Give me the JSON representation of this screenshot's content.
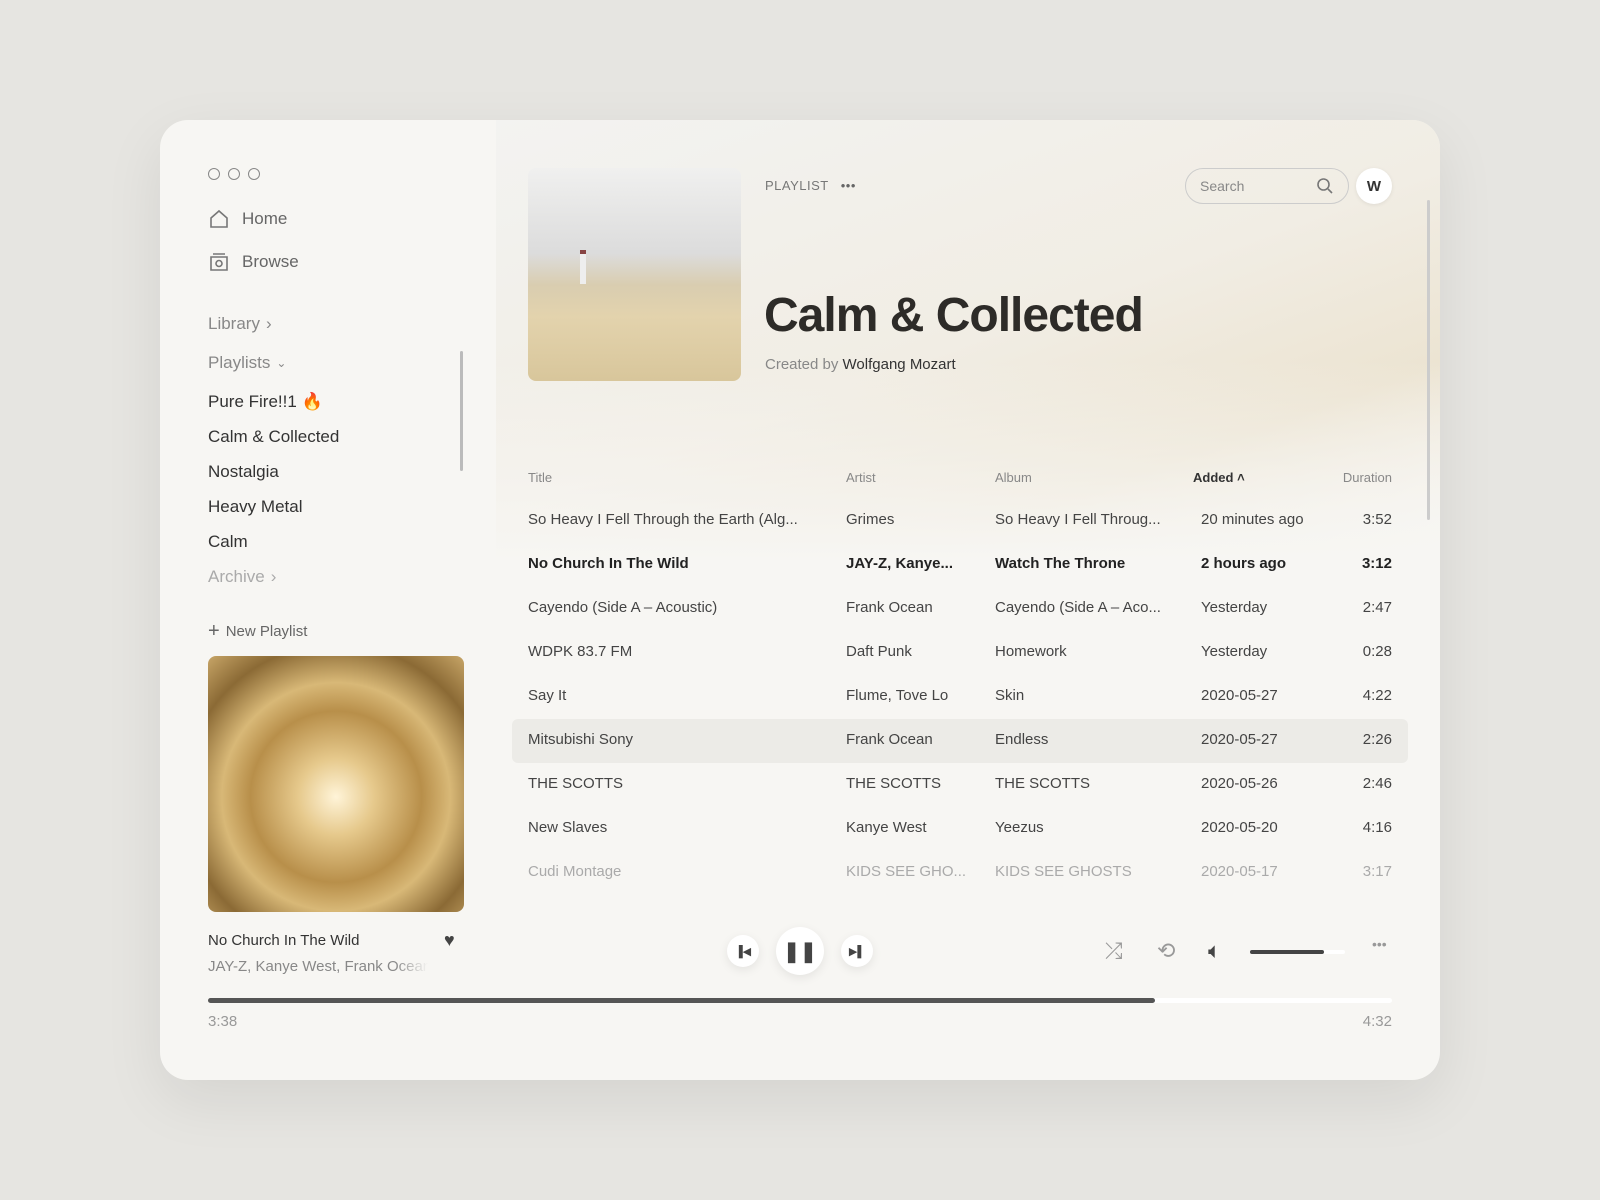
{
  "sidebar": {
    "nav": [
      {
        "label": "Home",
        "icon": "home-icon"
      },
      {
        "label": "Browse",
        "icon": "browse-icon"
      }
    ],
    "library": "Library",
    "playlists": "Playlists",
    "playlist_items": [
      "Pure Fire!!1 🔥",
      "Calm & Collected",
      "Nostalgia",
      "Heavy Metal",
      "Calm"
    ],
    "archive": "Archive",
    "new_playlist": "New Playlist"
  },
  "now_playing": {
    "title": "No Church In The Wild",
    "artist": "JAY-Z, Kanye West, Frank Ocean",
    "liked": true,
    "elapsed": "3:38",
    "total": "4:32",
    "progress": 0.8,
    "volume": 0.78
  },
  "header": {
    "kicker": "PLAYLIST",
    "title": "Calm & Collected",
    "created_by_label": "Created by",
    "creator": "Wolfgang Mozart",
    "search_placeholder": "Search",
    "avatar": "W"
  },
  "table": {
    "columns": [
      "Title",
      "Artist",
      "Album",
      "Added",
      "Duration"
    ],
    "sort_column": "Added",
    "sort_dir": "asc",
    "rows": [
      [
        "So Heavy I Fell Through the Earth (Alg...",
        "Grimes",
        "So Heavy I Fell Throug...",
        "20 minutes ago",
        "3:52"
      ],
      [
        "No Church In The Wild",
        "JAY-Z, Kanye...",
        "Watch The Throne",
        "2 hours ago",
        "3:12"
      ],
      [
        "Cayendo (Side A – Acoustic)",
        "Frank Ocean",
        "Cayendo (Side A – Aco...",
        "Yesterday",
        "2:47"
      ],
      [
        "WDPK 83.7 FM",
        "Daft Punk",
        "Homework",
        "Yesterday",
        "0:28"
      ],
      [
        "Say It",
        "Flume, Tove Lo",
        "Skin",
        "2020-05-27",
        "4:22"
      ],
      [
        "Mitsubishi Sony",
        "Frank Ocean",
        "Endless",
        "2020-05-27",
        "2:26"
      ],
      [
        "THE SCOTTS",
        "THE SCOTTS",
        "THE SCOTTS",
        "2020-05-26",
        "2:46"
      ],
      [
        "New Slaves",
        "Kanye West",
        "Yeezus",
        "2020-05-20",
        "4:16"
      ],
      [
        "Cudi Montage",
        "KIDS SEE GHO...",
        "KIDS SEE GHOSTS",
        "2020-05-17",
        "3:17"
      ]
    ],
    "playing_row": 1,
    "hovered_row": 5
  }
}
